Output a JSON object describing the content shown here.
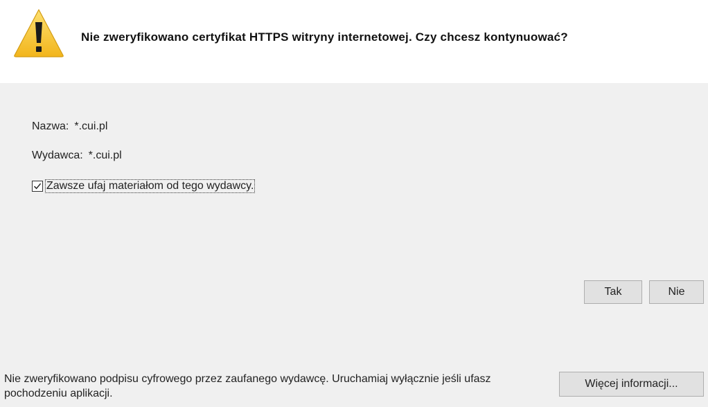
{
  "header": {
    "title": "Nie zweryfikowano certyfikat HTTPS witryny internetowej. Czy chcesz kontynuować?",
    "icon": "warning-icon",
    "icon_color": "#f7c325"
  },
  "details": {
    "name_label": "Nazwa:",
    "name_value": "*.cui.pl",
    "publisher_label": "Wydawca:",
    "publisher_value": "*.cui.pl"
  },
  "trust_checkbox": {
    "label": "Zawsze ufaj materiałom od tego wydawcy.",
    "checked": true
  },
  "buttons": {
    "yes": "Tak",
    "no": "Nie",
    "more_info": "Więcej informacji..."
  },
  "footer": {
    "text": "Nie zweryfikowano podpisu cyfrowego przez zaufanego wydawcę. Uruchamiaj wyłącznie jeśli ufasz pochodzeniu aplikacji."
  }
}
